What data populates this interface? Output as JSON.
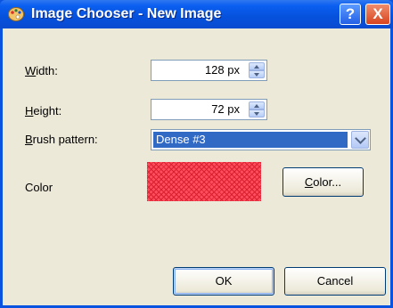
{
  "window": {
    "title": "Image Chooser - New Image",
    "help_label": "?",
    "close_label": "X"
  },
  "form": {
    "width": {
      "label_mnemonic": "W",
      "label_rest": "idth:",
      "value": "128 px"
    },
    "height": {
      "label_mnemonic": "H",
      "label_rest": "eight:",
      "value": "72 px"
    },
    "brush": {
      "label_mnemonic": "B",
      "label_rest": "rush pattern:",
      "selected": "Dense #3"
    },
    "color": {
      "label": "Color",
      "swatch_color": "#ff2d3c",
      "button_mnemonic": "C",
      "button_rest": "olor..."
    }
  },
  "buttons": {
    "ok": "OK",
    "cancel": "Cancel"
  },
  "colors": {
    "titlebar": "#0a5ff0",
    "client": "#ece9d8",
    "selection": "#316ac5"
  },
  "icons": {
    "app": "palette-icon",
    "spin": "spin-arrows-icon",
    "dropdown": "chevron-down-icon"
  }
}
